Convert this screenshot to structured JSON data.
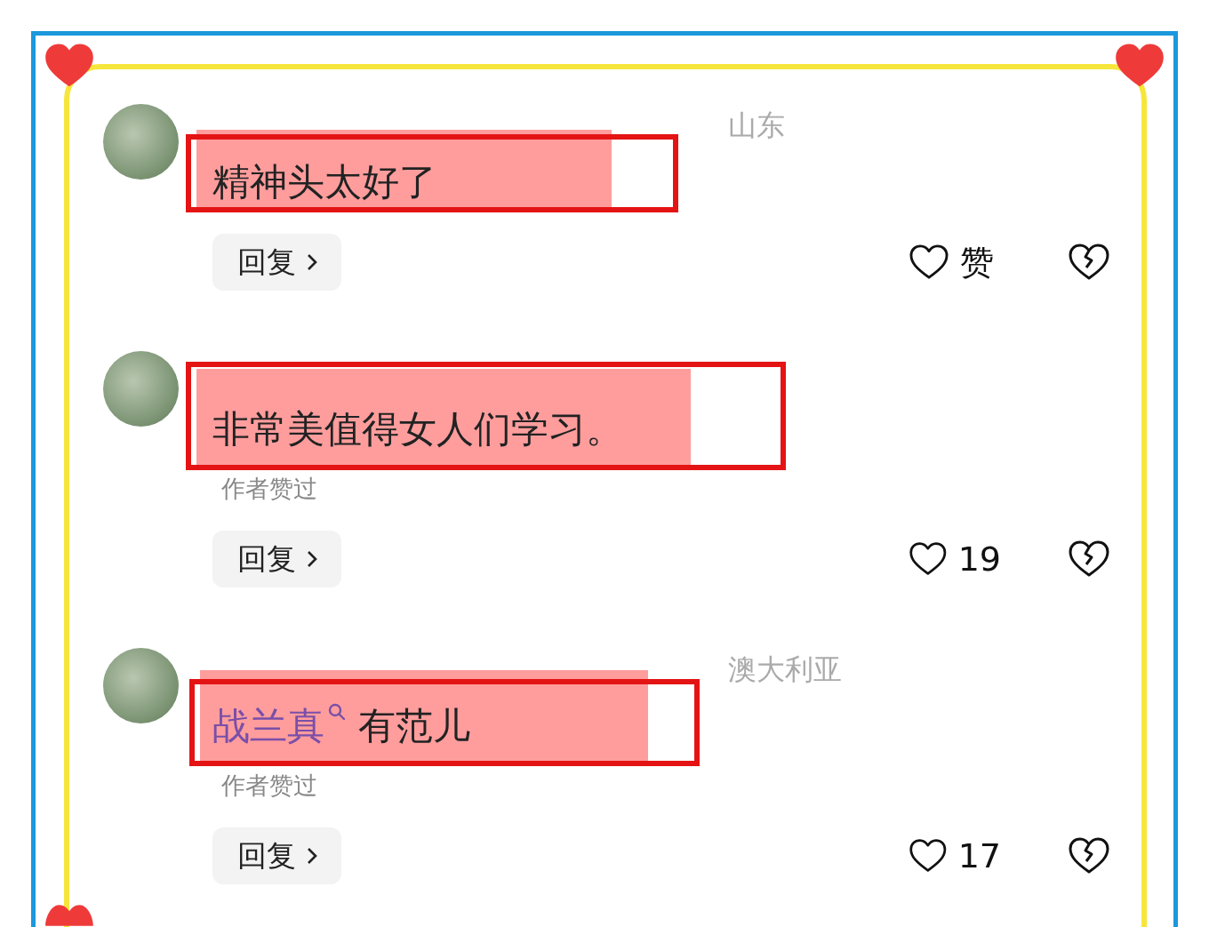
{
  "comments": [
    {
      "location": "山东",
      "highlighted": true,
      "text_parts": [
        {
          "kind": "text",
          "text": "精神头太好了"
        }
      ],
      "author_liked": false,
      "reply": "回复",
      "likes": "赞"
    },
    {
      "highlighted": true,
      "text_parts": [
        {
          "kind": "text",
          "text": "非常美值得女人们学习。"
        }
      ],
      "author_liked": true,
      "author_liked_label": "作者赞过",
      "reply": "回复",
      "likes": "19"
    },
    {
      "location": "澳大利亚",
      "highlighted": true,
      "text_parts": [
        {
          "kind": "link",
          "text": "战兰真"
        },
        {
          "kind": "text",
          "text": "有范儿"
        }
      ],
      "author_liked": true,
      "author_liked_label": "作者赞过",
      "reply": "回复",
      "likes": "17"
    }
  ]
}
